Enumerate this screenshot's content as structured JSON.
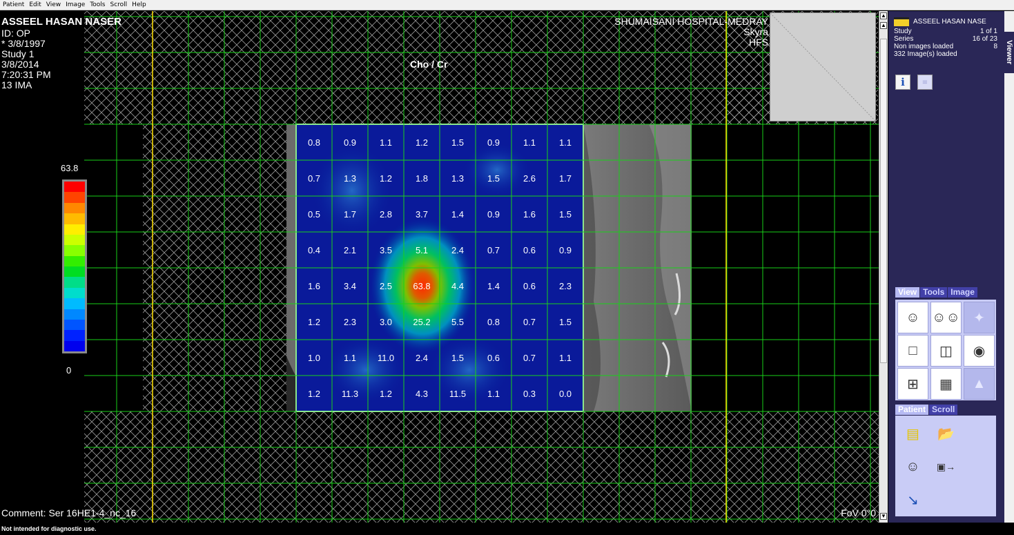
{
  "menu": [
    "Patient",
    "Edit",
    "View",
    "Image",
    "Tools",
    "Scroll",
    "Help"
  ],
  "overlay": {
    "patient_name": "ASSEEL HASAN NASER",
    "patient_lines": [
      "ID: OP",
      "* 3/8/1997",
      "Study 1",
      "3/8/2014",
      "7:20:31 PM",
      "13 IMA"
    ],
    "hospital_lines": [
      "SHUMAISANI HOSPITAL-MEDRAY",
      "Skyra",
      "HFS"
    ],
    "map_title": "Cho / Cr",
    "comment": "Comment: Ser 16HE1-4_nc_16",
    "fov": "FoV 0°0"
  },
  "color_scale": {
    "max_label": "63.8",
    "min_label": "0",
    "colors": [
      "#ff0000",
      "#ff4400",
      "#ff8800",
      "#ffbb00",
      "#ffee00",
      "#ccff00",
      "#88ff00",
      "#33ee00",
      "#00dd22",
      "#00dd88",
      "#00ddcc",
      "#00bbff",
      "#0088ff",
      "#0055ff",
      "#0022ff",
      "#0000ee"
    ]
  },
  "csi_grid": {
    "rows": [
      [
        "0.8",
        "0.9",
        "1.1",
        "1.2",
        "1.5",
        "0.9",
        "1.1",
        "1.1"
      ],
      [
        "0.7",
        "1.3",
        "1.2",
        "1.8",
        "1.3",
        "1.5",
        "2.6",
        "1.7"
      ],
      [
        "0.5",
        "1.7",
        "2.8",
        "3.7",
        "1.4",
        "0.9",
        "1.6",
        "1.5"
      ],
      [
        "0.4",
        "2.1",
        "3.5",
        "5.1",
        "2.4",
        "0.7",
        "0.6",
        "0.9"
      ],
      [
        "1.6",
        "3.4",
        "2.5",
        "63.8",
        "4.4",
        "1.4",
        "0.6",
        "2.3"
      ],
      [
        "1.2",
        "2.3",
        "3.0",
        "25.2",
        "5.5",
        "0.8",
        "0.7",
        "1.5"
      ],
      [
        "1.0",
        "1.1",
        "11.0",
        "2.4",
        "1.5",
        "0.6",
        "0.7",
        "1.1"
      ],
      [
        "1.2",
        "11.3",
        "1.2",
        "4.3",
        "11.5",
        "1.1",
        "0.3",
        "0.0"
      ]
    ]
  },
  "info_panel": {
    "patient": "ASSEEL HASAN NASE",
    "study_label": "Study",
    "study_value": "1 of 1",
    "series_label": "Series",
    "series_value": "16 of 23",
    "non_images_label": "Non images loaded",
    "non_images_value": "8",
    "loaded": "332 Image(s) loaded"
  },
  "view_tabs": [
    "View",
    "Tools",
    "Image"
  ],
  "patient_tabs": [
    "Patient",
    "Scroll"
  ],
  "viewer_tab": "Viewer",
  "status": "Not intended for diagnostic use."
}
